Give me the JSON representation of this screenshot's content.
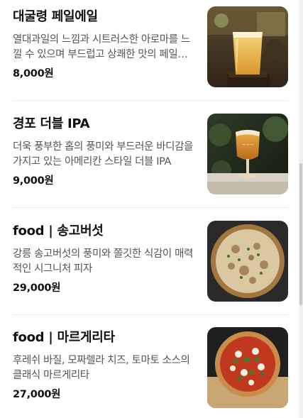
{
  "menu": {
    "items": [
      {
        "name": "대굴령 페일에일",
        "description": "열대과일의 느낌과 시트러스한 아로마를 느낄 수 있으며 부드럽고 상쾌한 맛의 페일에일",
        "price": "8,000원",
        "image": "pale-ale-glass-photo"
      },
      {
        "name": "경포 더블 IPA",
        "description": "더욱 풍부한 홉의 풍미와 부드러운 바디감을 가지고 있는 아메리칸 스타일 더블 IPA",
        "price": "9,000원",
        "image": "ipa-glass-photo"
      },
      {
        "name": "food | 송고버섯",
        "description": "강릉 송고버섯의 풍미와 쫄깃한 식감이 매력적인 시그니처 피자",
        "price": "29,000원",
        "image": "mushroom-pizza-photo"
      },
      {
        "name": "food | 마르게리타",
        "description": "후레쉬 바질, 모짜렐라 치즈, 토마토 소스의 클래식 마르게리타",
        "price": "27,000원",
        "image": "margherita-pizza-photo"
      }
    ]
  }
}
